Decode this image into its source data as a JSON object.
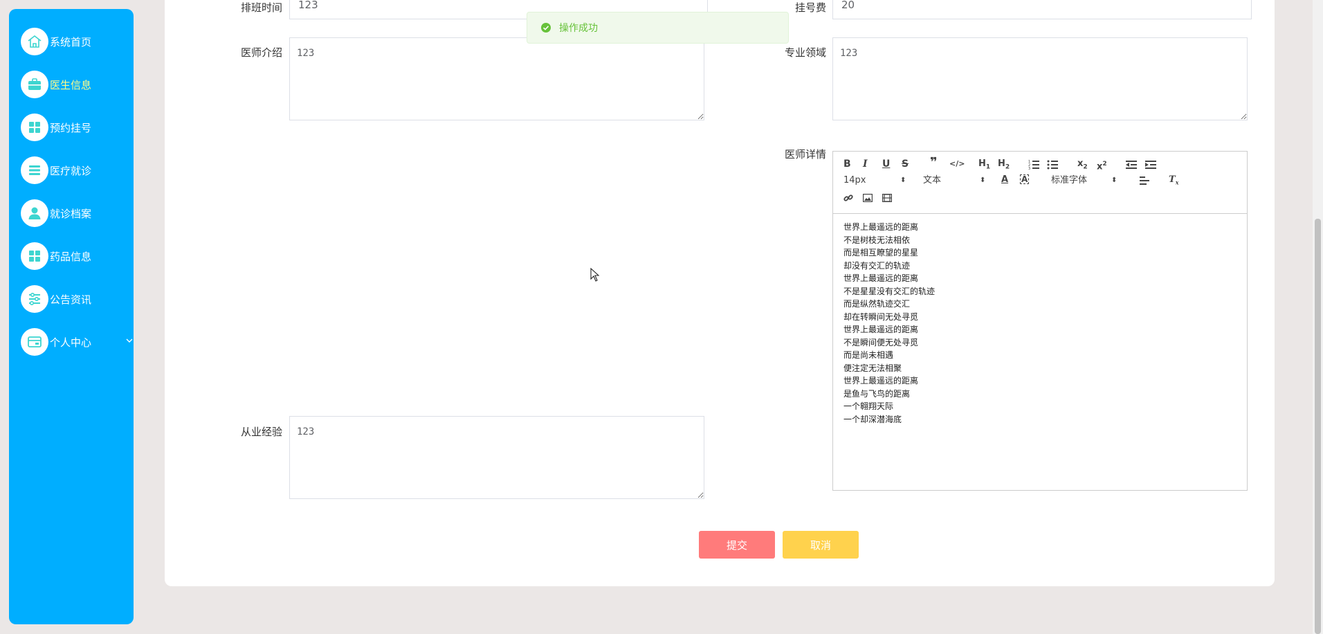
{
  "sidebar": {
    "items": [
      {
        "label": "系统首页",
        "icon": "home-icon"
      },
      {
        "label": "医生信息",
        "icon": "briefcase-icon",
        "active": true
      },
      {
        "label": "预约挂号",
        "icon": "grid-icon"
      },
      {
        "label": "医疗就诊",
        "icon": "list-icon"
      },
      {
        "label": "就诊档案",
        "icon": "user-icon"
      },
      {
        "label": "药品信息",
        "icon": "grid-icon"
      },
      {
        "label": "公告资讯",
        "icon": "sliders-icon"
      },
      {
        "label": "个人中心",
        "icon": "card-icon"
      }
    ],
    "accent": "#00aeff",
    "active_color": "#fffb8a"
  },
  "form": {
    "schedule_label": "排班时间",
    "schedule_value": "123",
    "fee_label": "挂号费",
    "fee_value": "20",
    "intro_label": "医师介绍",
    "intro_value": "123",
    "specialty_label": "专业领域",
    "specialty_value": "123",
    "detail_label": "医师详情",
    "experience_label": "从业经验",
    "experience_value": "123"
  },
  "editor": {
    "font_size": "14px",
    "header_type": "文本",
    "font_family": "标准字体",
    "lines": [
      "世界上最遥远的距离",
      "不是树枝无法相依",
      "而是相互瞭望的星星",
      "却没有交汇的轨迹",
      "世界上最遥远的距离",
      "不是星星没有交汇的轨迹",
      "而是纵然轨迹交汇",
      "却在转瞬间无处寻觅",
      "世界上最遥远的距离",
      "不是瞬间便无处寻觅",
      "而是尚未相遇",
      "便注定无法相聚",
      "世界上最遥远的距离",
      "是鱼与飞鸟的距离",
      "一个翱翔天际",
      "一个却深潜海底"
    ]
  },
  "buttons": {
    "submit": "提交",
    "cancel": "取消",
    "submit_color": "#ff7b7b",
    "cancel_color": "#ffd24d"
  },
  "toast": {
    "message": "操作成功",
    "color": "#67c23a"
  }
}
